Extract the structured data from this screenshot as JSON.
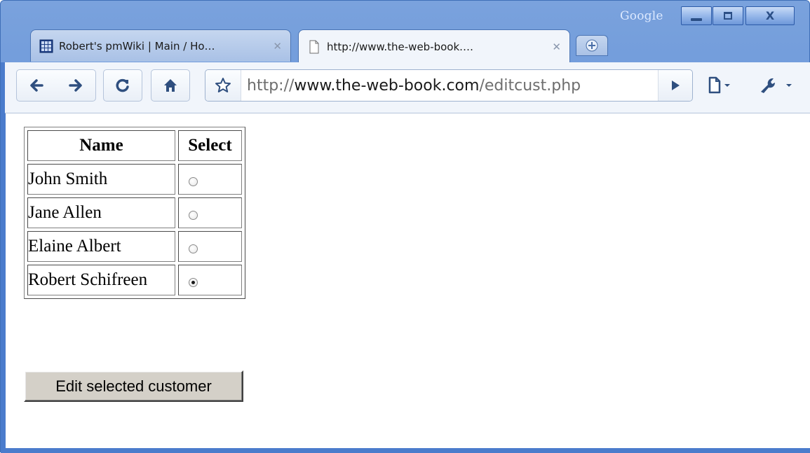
{
  "window": {
    "google_label": "Google",
    "controls": {
      "minimize": "minimize",
      "maximize": "maximize",
      "close": "X"
    }
  },
  "tabs": [
    {
      "title": "Robert's pmWiki | Main / Ho…",
      "icon": "grid-favicon-icon",
      "active": false
    },
    {
      "title": "http://www.the-web-book.…",
      "icon": "page-favicon-icon",
      "active": true
    }
  ],
  "toolbar": {
    "url_prefix": "http://",
    "url_host": "www.the-web-book.com",
    "url_path": "/editcust.php",
    "icons": [
      "back-icon",
      "forward-icon",
      "reload-icon",
      "home-icon",
      "star-icon",
      "go-icon",
      "page-menu-icon",
      "wrench-menu-icon"
    ]
  },
  "page": {
    "table": {
      "headers": [
        "Name",
        "Select"
      ],
      "rows": [
        {
          "name": "John Smith",
          "selected": false
        },
        {
          "name": "Jane Allen",
          "selected": false
        },
        {
          "name": "Elaine Albert",
          "selected": false
        },
        {
          "name": "Robert Schifreen",
          "selected": true
        }
      ]
    },
    "button_label": "Edit selected customer"
  },
  "colors": {
    "frame": "#5f8fd7",
    "toolbar_bg": "#f1f5fb",
    "button_face": "#d4d0c8"
  }
}
